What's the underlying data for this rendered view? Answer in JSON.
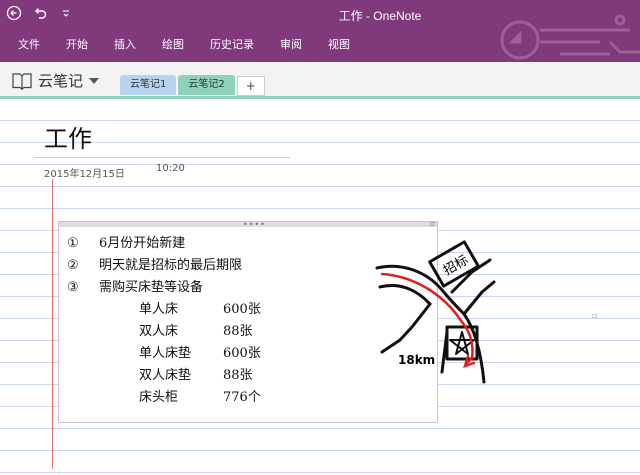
{
  "window": {
    "title": "工作 - OneNote"
  },
  "menu": [
    {
      "id": "file",
      "label": "文件"
    },
    {
      "id": "home",
      "label": "开始"
    },
    {
      "id": "insert",
      "label": "插入"
    },
    {
      "id": "draw",
      "label": "绘图"
    },
    {
      "id": "history",
      "label": "历史记录"
    },
    {
      "id": "review",
      "label": "审阅"
    },
    {
      "id": "view",
      "label": "视图"
    }
  ],
  "notebook": {
    "name": "云笔记",
    "sections": [
      {
        "label": "云笔记1",
        "color": "#b7d3f0"
      },
      {
        "label": "云笔记2",
        "color": "#8fd1bd",
        "active": true
      }
    ],
    "add_label": "+"
  },
  "page": {
    "title": "工作",
    "date": "2015年12月15日",
    "time": "10:20"
  },
  "note": {
    "items": [
      {
        "num": "①",
        "text": "6月份开始新建"
      },
      {
        "num": "②",
        "text": "明天就是招标的最后期限"
      },
      {
        "num": "③",
        "text": "需购买床垫等设备"
      }
    ],
    "equipment": [
      {
        "name": "单人床",
        "qty": "600张"
      },
      {
        "name": "双人床",
        "qty": "88张"
      },
      {
        "name": "单人床垫",
        "qty": "600张"
      },
      {
        "name": "双人床垫",
        "qty": "88张"
      },
      {
        "name": "床头柜",
        "qty": "776个"
      }
    ]
  },
  "sketch": {
    "sign_text": "招标",
    "distance_text": "18km"
  },
  "colors": {
    "accent": "#80397B",
    "active_tab": "#8fd1bd",
    "margin_line": "#e07070",
    "route": "#e02020"
  }
}
